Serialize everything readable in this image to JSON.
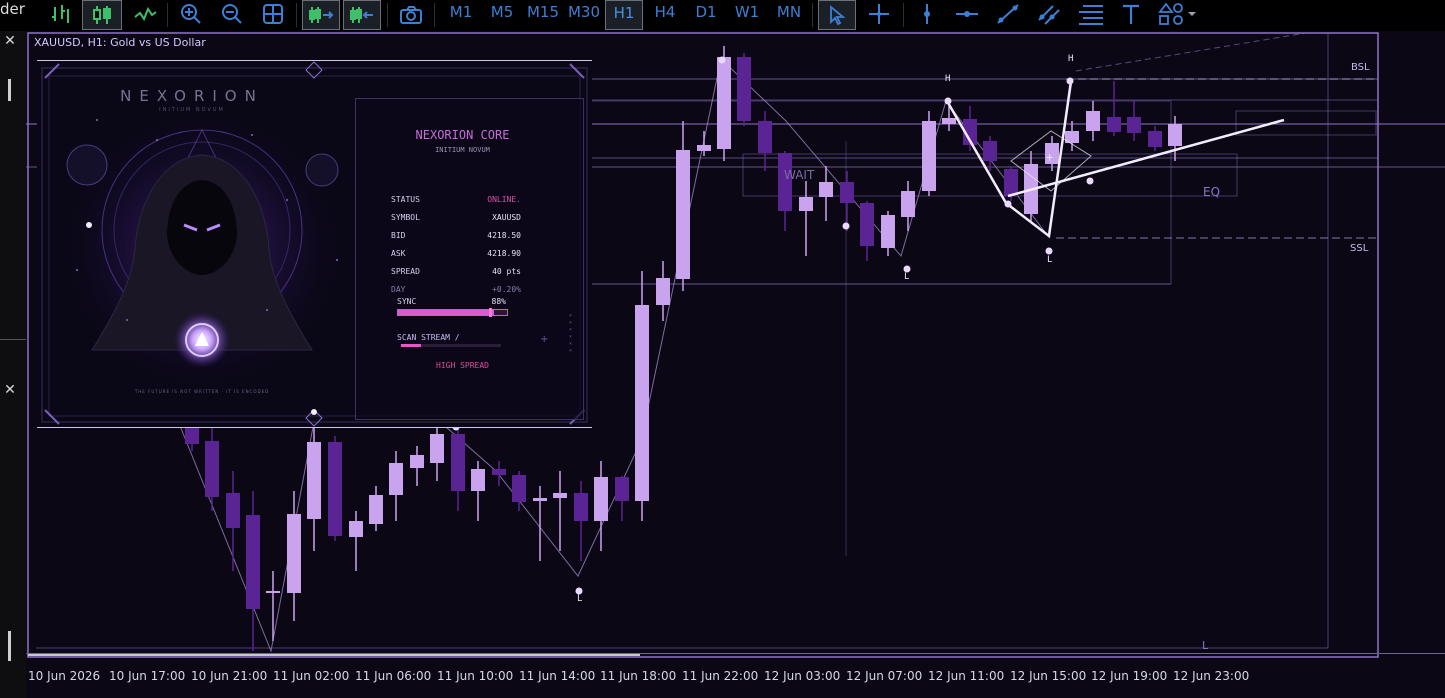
{
  "toolbar": {
    "timeframes": [
      "M1",
      "M5",
      "M15",
      "M30",
      "H1",
      "H4",
      "D1",
      "W1",
      "MN"
    ],
    "selected_timeframe": "H1"
  },
  "left_panel": {
    "cut_text": "der",
    "close_glyph": "✕"
  },
  "chart": {
    "symbol_line": "XAUUSD, H1:  Gold vs US Dollar",
    "time_labels": [
      "10 Jun 2026",
      "10 Jun 17:00",
      "10 Jun 21:00",
      "11 Jun 02:00",
      "11 Jun 06:00",
      "11 Jun 10:00",
      "11 Jun 14:00",
      "11 Jun 18:00",
      "11 Jun 22:00",
      "12 Jun 03:00",
      "12 Jun 07:00",
      "12 Jun 11:00",
      "12 Jun 15:00",
      "12 Jun 19:00",
      "12 Jun 23:00"
    ],
    "levels": {
      "bsl": "BSL",
      "ssl": "SSL",
      "eq": "EQ",
      "wait": "WAIT",
      "l_bottom": "L"
    },
    "swing_points": {
      "high": "H",
      "low": "L",
      "plus": "+"
    },
    "colors": {
      "bull": "#c9a3ee",
      "bear": "#5a2494",
      "frame": "#8f74c8",
      "background": "#0b0714"
    }
  },
  "panel": {
    "brand": "NEXORION",
    "brand_sub": "INITIUM NOVUM",
    "tagline": "THE FUTURE IS NOT WRITTEN · IT IS ENCODED",
    "core_title": "NEXORION CORE",
    "core_sub": "INITIUM NOVUM",
    "rows": [
      {
        "label": "STATUS",
        "value": "ONLINE."
      },
      {
        "label": "SYMBOL",
        "value": "XAUUSD"
      },
      {
        "label": "BID",
        "value": "4218.50"
      },
      {
        "label": "ASK",
        "value": "4218.90"
      },
      {
        "label": "SPREAD",
        "value": "40 pts"
      },
      {
        "label": "DAY",
        "value": "+0.20%"
      }
    ],
    "sync_label": "SYNC",
    "sync_value": "88%",
    "sync_fraction": 0.88,
    "scan_label": "SCAN STREAM  /",
    "scan_fraction": 0.2,
    "alert": "HIGH SPREAD",
    "status_color": "#d94fa8",
    "alert_color": "#e04a9a"
  }
}
